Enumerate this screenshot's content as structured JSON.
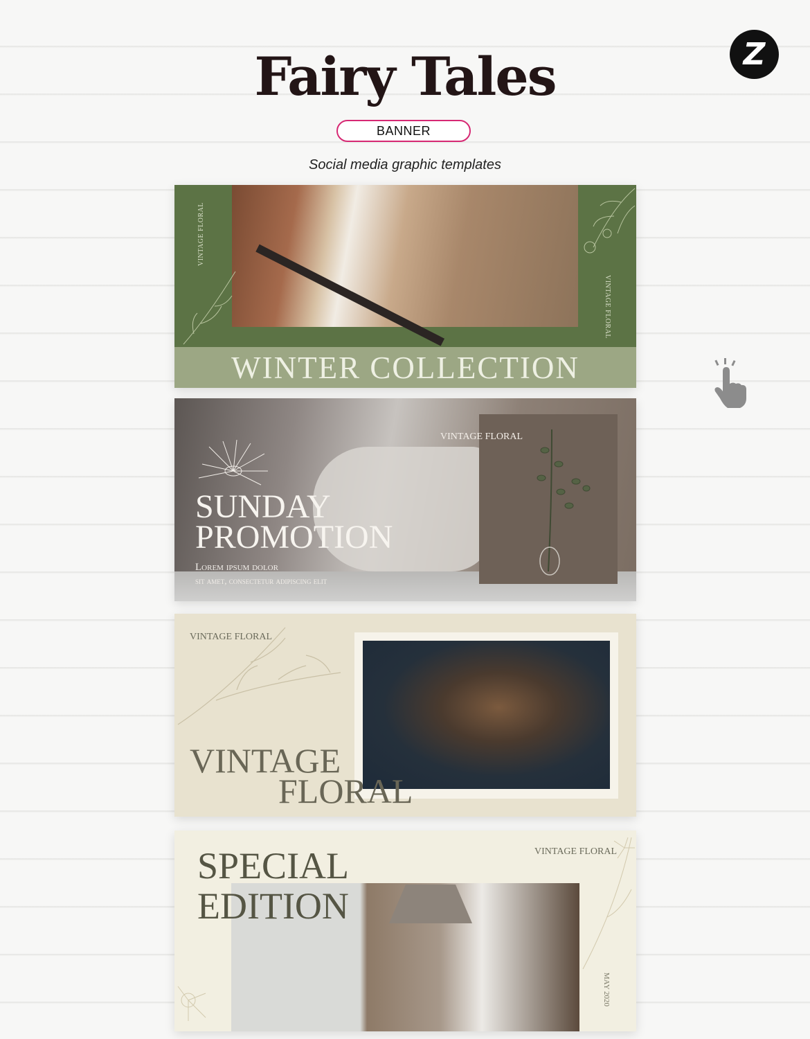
{
  "header": {
    "title": "Fairy Tales",
    "badge": "BANNER",
    "subtitle": "Social media graphic templates",
    "logo_letter": "Z"
  },
  "icons": {
    "logo": "brand-logo-icon",
    "pointer": "hand-pointer-icon"
  },
  "banners": [
    {
      "vertical_label": "VINTAGE FLORAL",
      "vertical_label_2": "VINTAGE FLORAL",
      "headline": "WINTER COLLECTION"
    },
    {
      "tag": "VINTAGE FLORAL",
      "headline_1": "SUNDAY",
      "headline_2": "PROMOTION",
      "body_1": "Lorem ipsum dolor",
      "body_2": "sit amet, consectetur adipiscing elit"
    },
    {
      "tag": "VINTAGE FLORAL",
      "headline_1": "VINTAGE",
      "headline_2": "FLORAL"
    },
    {
      "tag": "VINTAGE FLORAL",
      "headline_1": "SPECIAL",
      "headline_2": "EDITION",
      "date": "MAY 2020"
    }
  ],
  "colors": {
    "badge_border": "#d62873",
    "banner1_bg": "#5c7345",
    "banner1_band": "#9ca784",
    "banner3_bg": "#e8e2cf",
    "banner4_bg": "#f2efe1"
  }
}
